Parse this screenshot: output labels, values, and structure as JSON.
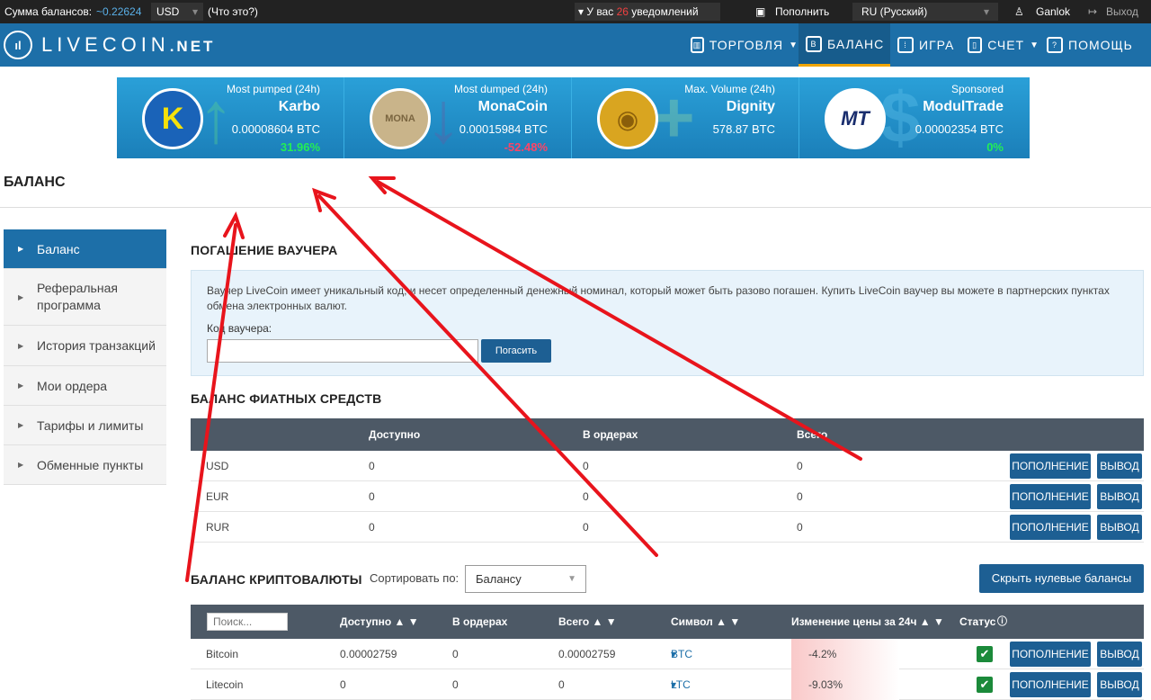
{
  "topbar": {
    "balance_label": "Сумма балансов:",
    "balance_value": "~0.22624",
    "currency": "USD",
    "what_is": "(Что это?)",
    "notif_prefix": "У вас",
    "notif_count": "26",
    "notif_suffix": "уведомлений",
    "deposit": "Пополнить",
    "language": "RU (Русский)",
    "user": "Ganlok",
    "logout": "Выход"
  },
  "navbar": {
    "logo_mark": "ıl",
    "logo_text": "LIVECOIN",
    "logo_suffix": ".NET",
    "items": [
      {
        "label": "ТОРГОВЛЯ"
      },
      {
        "label": "БАЛАНС"
      },
      {
        "label": "ИГРА"
      },
      {
        "label": "СЧЕТ"
      },
      {
        "label": "ПОМОЩЬ"
      }
    ]
  },
  "banner": [
    {
      "tag": "Most pumped (24h)",
      "name": "Karbo",
      "price": "0.00008604 BTC",
      "change": "31.96%",
      "change_color": "#22ee55",
      "coin_symbol": "K",
      "coin_color": "#1a63b8",
      "deco": "↑"
    },
    {
      "tag": "Most dumped (24h)",
      "name": "MonaCoin",
      "price": "0.00015984 BTC",
      "change": "-52.48%",
      "change_color": "#ff4466",
      "coin_symbol": "MONA",
      "coin_color": "#c9b48a",
      "deco": "↓"
    },
    {
      "tag": "Max. Volume (24h)",
      "name": "Dignity",
      "price": "578.87 BTC",
      "change": "",
      "change_color": "#ffffff",
      "coin_symbol": "◉",
      "coin_color": "#d9a520",
      "deco": "+"
    },
    {
      "tag": "Sponsored",
      "name": "ModulTrade",
      "price": "0.00002354 BTC",
      "change": "0%",
      "change_color": "#22ee55",
      "coin_symbol": "MT",
      "coin_color": "#1a2e6e",
      "deco": "$"
    }
  ],
  "page_title": "БАЛАНС",
  "sidebar": {
    "items": [
      {
        "label": "Баланс"
      },
      {
        "label": "Реферальная программа"
      },
      {
        "label": "История транзакций"
      },
      {
        "label": "Мои ордера"
      },
      {
        "label": "Тарифы и лимиты"
      },
      {
        "label": "Обменные пункты"
      }
    ]
  },
  "voucher": {
    "title": "ПОГАШЕНИЕ ВАУЧЕРА",
    "description": "Ваучер LiveCoin имеет уникальный код, и несет определенный денежный номинал, который может быть разово погашен. Купить LiveCoin ваучер вы можете в партнерских пунктах обмена электронных валют.",
    "code_label": "Код ваучера:",
    "code_value": "",
    "redeem_button": "Погасить"
  },
  "fiat": {
    "title": "БАЛАНС ФИАТНЫХ СРЕДСТВ",
    "headers": [
      "Доступно",
      "В ордерах",
      "Всего"
    ],
    "rows": [
      {
        "currency": "USD",
        "available": "0",
        "in_orders": "0",
        "total": "0"
      },
      {
        "currency": "EUR",
        "available": "0",
        "in_orders": "0",
        "total": "0"
      },
      {
        "currency": "RUR",
        "available": "0",
        "in_orders": "0",
        "total": "0"
      }
    ],
    "deposit_button": "ПОПОЛНЕНИЕ",
    "withdraw_button": "ВЫВОД"
  },
  "crypto": {
    "title": "БАЛАНС КРИПТОВАЛЮТЫ",
    "sort_label": "Сортировать по:",
    "sort_value": "Балансу",
    "hide_zero_button": "Скрыть нулевые балансы",
    "search_placeholder": "Поиск...",
    "headers": {
      "available": "Доступно ▲ ▼",
      "in_orders": "В ордерах",
      "total": "Всего ▲ ▼",
      "symbol": "Символ ▲ ▼",
      "change": "Изменение цены за 24ч ▲ ▼",
      "status": "Статус"
    },
    "rows": [
      {
        "name": "Bitcoin",
        "available": "0.00002759",
        "in_orders": "0",
        "total": "0.00002759",
        "symbol": "BTC",
        "change": "-4.2%"
      },
      {
        "name": "Litecoin",
        "available": "0",
        "in_orders": "0",
        "total": "0",
        "symbol": "LTC",
        "change": "-9.03%"
      }
    ],
    "deposit_button": "ПОПОЛНЕНИЕ",
    "withdraw_button": "ВЫВОД"
  },
  "colors": {
    "accent": "#1d6fa8",
    "button": "#1d5f93",
    "header_bar": "#222222",
    "table_header": "#4d5966",
    "annotation_arrows": "#e8141c"
  }
}
